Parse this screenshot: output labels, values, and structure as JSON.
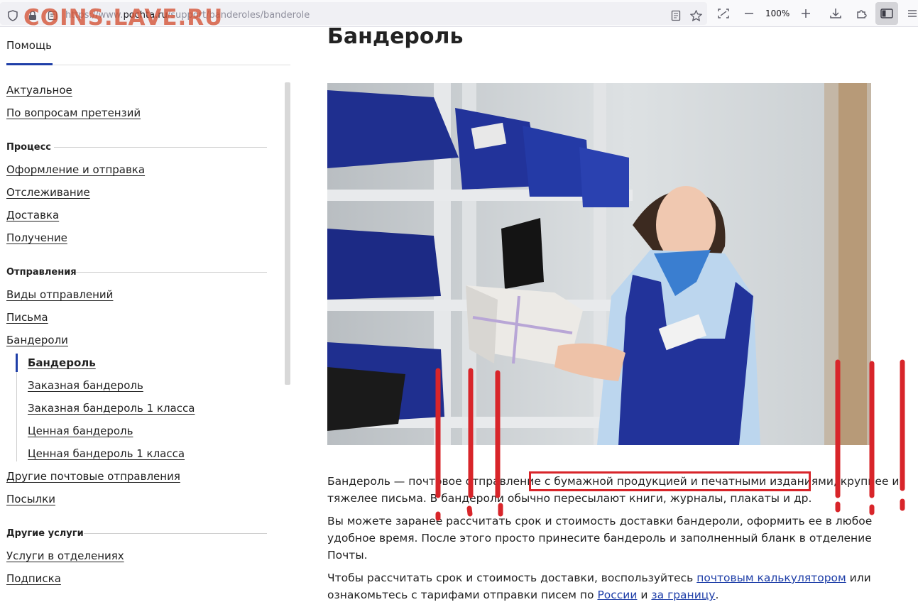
{
  "browser": {
    "url_prefix": "https://www.",
    "url_domain": "pochta.ru",
    "url_path": "/support/banderoles/banderole",
    "zoom": "100%",
    "icons": [
      "shield-icon",
      "lock-icon",
      "page-icon",
      "reader-icon",
      "star-icon",
      "screenshot-icon",
      "zoom-out-icon",
      "zoom-in-icon",
      "download-icon",
      "extensions-icon",
      "sidebar-icon",
      "menu-icon"
    ]
  },
  "watermark": "COINS.LAVE.RU",
  "nav": {
    "help_tab": "Помощь",
    "top_links": [
      "Актуальное",
      "По вопросам претензий"
    ],
    "process_head": "Процесс",
    "process_links": [
      "Оформление и отправка",
      "Отслеживание",
      "Доставка",
      "Получение"
    ],
    "shipments_head": "Отправления",
    "shipments_links": [
      "Виды отправлений",
      "Письма",
      "Бандероли"
    ],
    "sub_links": [
      "Бандероль",
      "Заказная бандероль",
      "Заказная бандероль 1 класса",
      "Ценная бандероль",
      "Ценная бандероль 1 класса"
    ],
    "after_links": [
      "Другие почтовые отправления",
      "Посылки"
    ],
    "services_head": "Другие услуги",
    "services_links": [
      "Услуги в отделениях",
      "Подписка"
    ]
  },
  "main": {
    "title": "Бандероль",
    "p1_a": "Бандероль — почтовое отправление ",
    "p1_b": "с бумажной продукцией и печатными изданиями",
    "p1_c": ", крупнее и",
    "p1_line2": "тяжелее письма. В бандероли обычно пересылают книги, журналы, плакаты и др.",
    "p2_line1": "Вы можете заранее рассчитать срок и стоимость доставки бандероли, оформить ее в любое",
    "p2_line2": "удобное время. После этого просто принесите бандероль и заполненный бланк в отделение",
    "p2_line3": "Почты.",
    "p3_a": "Чтобы рассчитать срок и стоимость доставки, воспользуйтесь ",
    "p3_link_calc": "почтовым калькулятором",
    "p3_b": " или",
    "p3_c": "ознакомьтесь с тарифами отправки писем по ",
    "p3_link_russia": "России",
    "p3_d": " и ",
    "p3_link_abroad": "за границу",
    "p3_e": "."
  },
  "colors": {
    "accent": "#1f3fa8",
    "annotation_red": "#d8252a",
    "watermark": "#d45032"
  }
}
